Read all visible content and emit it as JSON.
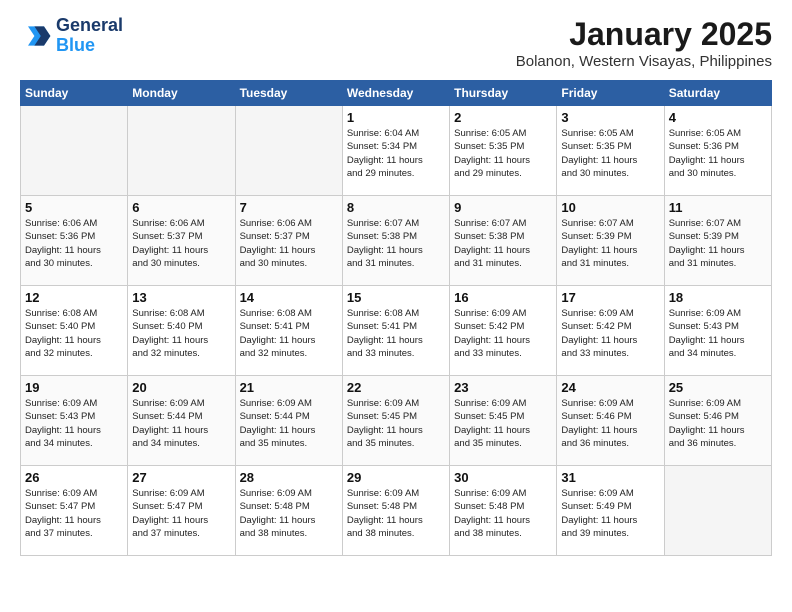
{
  "header": {
    "logo_line1": "General",
    "logo_line2": "Blue",
    "month": "January 2025",
    "location": "Bolanon, Western Visayas, Philippines"
  },
  "weekdays": [
    "Sunday",
    "Monday",
    "Tuesday",
    "Wednesday",
    "Thursday",
    "Friday",
    "Saturday"
  ],
  "weeks": [
    [
      {
        "day": "",
        "info": ""
      },
      {
        "day": "",
        "info": ""
      },
      {
        "day": "",
        "info": ""
      },
      {
        "day": "1",
        "info": "Sunrise: 6:04 AM\nSunset: 5:34 PM\nDaylight: 11 hours\nand 29 minutes."
      },
      {
        "day": "2",
        "info": "Sunrise: 6:05 AM\nSunset: 5:35 PM\nDaylight: 11 hours\nand 29 minutes."
      },
      {
        "day": "3",
        "info": "Sunrise: 6:05 AM\nSunset: 5:35 PM\nDaylight: 11 hours\nand 30 minutes."
      },
      {
        "day": "4",
        "info": "Sunrise: 6:05 AM\nSunset: 5:36 PM\nDaylight: 11 hours\nand 30 minutes."
      }
    ],
    [
      {
        "day": "5",
        "info": "Sunrise: 6:06 AM\nSunset: 5:36 PM\nDaylight: 11 hours\nand 30 minutes."
      },
      {
        "day": "6",
        "info": "Sunrise: 6:06 AM\nSunset: 5:37 PM\nDaylight: 11 hours\nand 30 minutes."
      },
      {
        "day": "7",
        "info": "Sunrise: 6:06 AM\nSunset: 5:37 PM\nDaylight: 11 hours\nand 30 minutes."
      },
      {
        "day": "8",
        "info": "Sunrise: 6:07 AM\nSunset: 5:38 PM\nDaylight: 11 hours\nand 31 minutes."
      },
      {
        "day": "9",
        "info": "Sunrise: 6:07 AM\nSunset: 5:38 PM\nDaylight: 11 hours\nand 31 minutes."
      },
      {
        "day": "10",
        "info": "Sunrise: 6:07 AM\nSunset: 5:39 PM\nDaylight: 11 hours\nand 31 minutes."
      },
      {
        "day": "11",
        "info": "Sunrise: 6:07 AM\nSunset: 5:39 PM\nDaylight: 11 hours\nand 31 minutes."
      }
    ],
    [
      {
        "day": "12",
        "info": "Sunrise: 6:08 AM\nSunset: 5:40 PM\nDaylight: 11 hours\nand 32 minutes."
      },
      {
        "day": "13",
        "info": "Sunrise: 6:08 AM\nSunset: 5:40 PM\nDaylight: 11 hours\nand 32 minutes."
      },
      {
        "day": "14",
        "info": "Sunrise: 6:08 AM\nSunset: 5:41 PM\nDaylight: 11 hours\nand 32 minutes."
      },
      {
        "day": "15",
        "info": "Sunrise: 6:08 AM\nSunset: 5:41 PM\nDaylight: 11 hours\nand 33 minutes."
      },
      {
        "day": "16",
        "info": "Sunrise: 6:09 AM\nSunset: 5:42 PM\nDaylight: 11 hours\nand 33 minutes."
      },
      {
        "day": "17",
        "info": "Sunrise: 6:09 AM\nSunset: 5:42 PM\nDaylight: 11 hours\nand 33 minutes."
      },
      {
        "day": "18",
        "info": "Sunrise: 6:09 AM\nSunset: 5:43 PM\nDaylight: 11 hours\nand 34 minutes."
      }
    ],
    [
      {
        "day": "19",
        "info": "Sunrise: 6:09 AM\nSunset: 5:43 PM\nDaylight: 11 hours\nand 34 minutes."
      },
      {
        "day": "20",
        "info": "Sunrise: 6:09 AM\nSunset: 5:44 PM\nDaylight: 11 hours\nand 34 minutes."
      },
      {
        "day": "21",
        "info": "Sunrise: 6:09 AM\nSunset: 5:44 PM\nDaylight: 11 hours\nand 35 minutes."
      },
      {
        "day": "22",
        "info": "Sunrise: 6:09 AM\nSunset: 5:45 PM\nDaylight: 11 hours\nand 35 minutes."
      },
      {
        "day": "23",
        "info": "Sunrise: 6:09 AM\nSunset: 5:45 PM\nDaylight: 11 hours\nand 35 minutes."
      },
      {
        "day": "24",
        "info": "Sunrise: 6:09 AM\nSunset: 5:46 PM\nDaylight: 11 hours\nand 36 minutes."
      },
      {
        "day": "25",
        "info": "Sunrise: 6:09 AM\nSunset: 5:46 PM\nDaylight: 11 hours\nand 36 minutes."
      }
    ],
    [
      {
        "day": "26",
        "info": "Sunrise: 6:09 AM\nSunset: 5:47 PM\nDaylight: 11 hours\nand 37 minutes."
      },
      {
        "day": "27",
        "info": "Sunrise: 6:09 AM\nSunset: 5:47 PM\nDaylight: 11 hours\nand 37 minutes."
      },
      {
        "day": "28",
        "info": "Sunrise: 6:09 AM\nSunset: 5:48 PM\nDaylight: 11 hours\nand 38 minutes."
      },
      {
        "day": "29",
        "info": "Sunrise: 6:09 AM\nSunset: 5:48 PM\nDaylight: 11 hours\nand 38 minutes."
      },
      {
        "day": "30",
        "info": "Sunrise: 6:09 AM\nSunset: 5:48 PM\nDaylight: 11 hours\nand 38 minutes."
      },
      {
        "day": "31",
        "info": "Sunrise: 6:09 AM\nSunset: 5:49 PM\nDaylight: 11 hours\nand 39 minutes."
      },
      {
        "day": "",
        "info": ""
      }
    ]
  ]
}
